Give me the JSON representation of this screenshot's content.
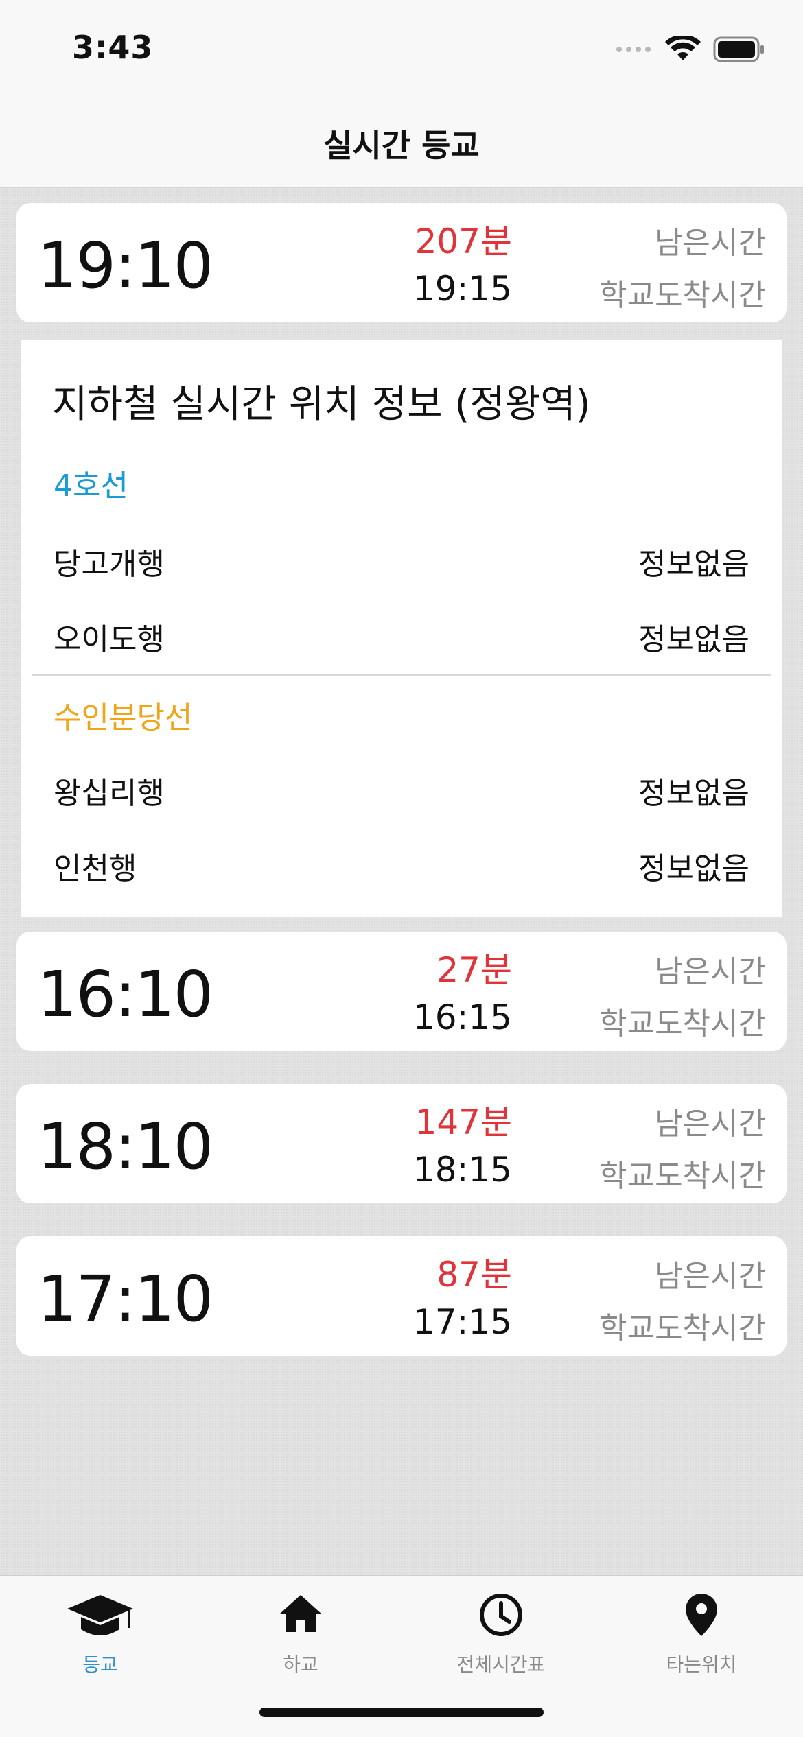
{
  "status_bar": {
    "time": "3:43"
  },
  "nav": {
    "title": "실시간 등교"
  },
  "cards": [
    {
      "departure": "19:10",
      "remaining": "207분",
      "arrival": "19:15",
      "remaining_label": "남은시간",
      "arrival_label": "학교도착시간"
    },
    {
      "departure": "16:10",
      "remaining": "27분",
      "arrival": "16:15",
      "remaining_label": "남은시간",
      "arrival_label": "학교도착시간"
    },
    {
      "departure": "18:10",
      "remaining": "147분",
      "arrival": "18:15",
      "remaining_label": "남은시간",
      "arrival_label": "학교도착시간"
    },
    {
      "departure": "17:10",
      "remaining": "87분",
      "arrival": "17:15",
      "remaining_label": "남은시간",
      "arrival_label": "학교도착시간"
    }
  ],
  "subway": {
    "title": "지하철 실시간 위치 정보 (정왕역)",
    "lines": [
      {
        "name": "4호선",
        "color": "#1a9ad6",
        "rows": [
          {
            "dest": "당고개행",
            "info": "정보없음"
          },
          {
            "dest": "오이도행",
            "info": "정보없음"
          }
        ]
      },
      {
        "name": "수인분당선",
        "color": "#f0a417",
        "rows": [
          {
            "dest": "왕십리행",
            "info": "정보없음"
          },
          {
            "dest": "인천행",
            "info": "정보없음"
          }
        ]
      }
    ]
  },
  "tabs": [
    {
      "label": "등교",
      "icon": "graduation-cap-icon",
      "active": true
    },
    {
      "label": "하교",
      "icon": "home-icon",
      "active": false
    },
    {
      "label": "전체시간표",
      "icon": "clock-icon",
      "active": false
    },
    {
      "label": "타는위치",
      "icon": "map-pin-icon",
      "active": false
    }
  ],
  "colors": {
    "remaining": "#e0333a",
    "active_tab": "#2f8ed1",
    "muted": "#8a8a8a"
  }
}
